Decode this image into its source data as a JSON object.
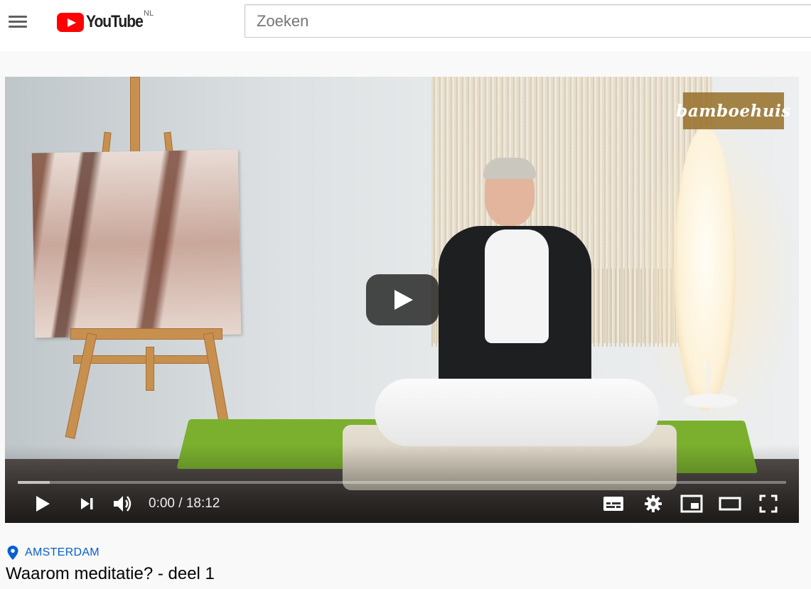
{
  "masthead": {
    "menu_icon": "hamburger-menu-icon",
    "logo_icon": "youtube-play-icon",
    "logo_text": "YouTube",
    "country_code": "NL",
    "search_placeholder": "Zoeken"
  },
  "player": {
    "channel_watermark": "bamboehuis",
    "progress_loaded_fraction": 0.042,
    "current_time": "0:00",
    "separator": "/",
    "duration": "18:12",
    "time_display": "0:00 / 18:12",
    "icons": {
      "big_play": "large-play-icon",
      "play": "play-icon",
      "next": "next-icon",
      "volume": "volume-icon",
      "subtitles": "subtitles-icon",
      "settings": "gear-icon",
      "miniplayer": "miniplayer-icon",
      "theater": "theater-mode-icon",
      "fullscreen": "fullscreen-icon"
    },
    "colors": {
      "brand_red": "#ff0000",
      "link_blue": "#065fd4"
    }
  },
  "video_info": {
    "location_icon": "map-pin-icon",
    "location": "AMSTERDAM",
    "title": "Waarom meditatie? - deel 1"
  }
}
